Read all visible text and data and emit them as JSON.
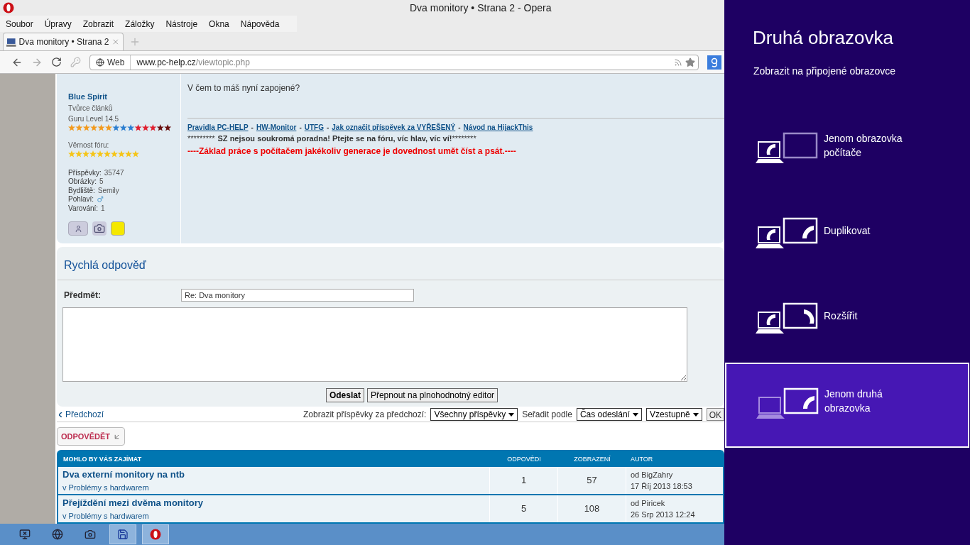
{
  "window": {
    "title": "Dva monitory • Strana 2 - Opera"
  },
  "menu": [
    "Soubor",
    "Úpravy",
    "Zobrazit",
    "Záložky",
    "Nástroje",
    "Okna",
    "Nápověda"
  ],
  "tabs": [
    {
      "label": "Dva monitory • Strana 2",
      "selected": true
    }
  ],
  "address": {
    "badge": "Web",
    "domain": "www.pc-help.cz",
    "path": "/viewtopic.php"
  },
  "post": {
    "author": "Blue Spirit",
    "rank": "Tvůrce článků",
    "level": "Guru Level 14.5",
    "loyalty_label": "Věrnost fóru:",
    "stars": 10,
    "details": [
      {
        "label": "Příspěvky:",
        "value": "35747"
      },
      {
        "label": "Obrázky:",
        "value": "5"
      },
      {
        "label": "Bydliště:",
        "value": "Semily"
      },
      {
        "label": "Pohlaví:",
        "kind": "male"
      },
      {
        "label": "Varování:",
        "value": "1"
      }
    ],
    "body": "V čem to máš nyní zapojené?",
    "sig_links": [
      "Pravidla PC-HELP",
      "HW-Monitor",
      "UTFG",
      "Jak označit příspěvek za VYŘEŠENÝ",
      "Návod na HijackThis"
    ],
    "sig_separator": "-",
    "sig_line2": {
      "prefix": "*********",
      "bold": "SZ nejsou soukromá poradna! Ptejte se na fóru, víc hlav, víc ví!",
      "suffix": "********"
    },
    "sig_line3": "----Základ práce s počítačem jakékoliv generace je dovednost umět číst a psát.----"
  },
  "quick_reply": {
    "title": "Rychlá odpověď",
    "subject_label": "Předmět:",
    "subject_value": "Re: Dva monitory",
    "submit": "Odeslat",
    "full_editor": "Přepnout na plnohodnotný editor"
  },
  "pagination": {
    "prev": "Předchozí",
    "show_label": "Zobrazit příspěvky za předchozí:",
    "show_value": "Všechny příspěvky",
    "sort_label": "Seřadit podle",
    "sort_value": "Čas odeslání",
    "order_value": "Vzestupně",
    "ok": "OK"
  },
  "reply_button": "ODPOVĚDĚT",
  "related": {
    "columns": [
      "MOHLO BY VÁS ZAJÍMAT",
      "ODPOVĚDI",
      "ZOBRAZENÍ",
      "AUTOR"
    ],
    "rows": [
      {
        "title": "Dva externí monitory na ntb",
        "forum": "v Problémy s hardwarem",
        "replies": "1",
        "views": "57",
        "author": "od BigZahry",
        "date": "17 Říj 2013 18:53"
      },
      {
        "title": "Přejíždění mezi dvěma monitory",
        "forum": "v Problémy s hardwarem",
        "replies": "5",
        "views": "108",
        "author": "od Piricek",
        "date": "26 Srp 2013 12:24"
      }
    ]
  },
  "taskbar": [
    {
      "kind": "display",
      "active": false
    },
    {
      "kind": "globe",
      "active": false
    },
    {
      "kind": "camera",
      "active": false
    },
    {
      "kind": "save",
      "active": true
    },
    {
      "kind": "opera",
      "active": true
    }
  ],
  "project": {
    "title": "Druhá obrazovka",
    "subtitle": "Zobrazit na připojené obrazovce",
    "options": [
      {
        "kind": "pc_only",
        "label": "Jenom obrazovka počítače",
        "selected": false
      },
      {
        "kind": "duplicate",
        "label": "Duplikovat",
        "selected": false
      },
      {
        "kind": "extend",
        "label": "Rozšířit",
        "selected": false
      },
      {
        "kind": "second_only",
        "label": "Jenom druhá obrazovka",
        "selected": true
      }
    ]
  }
}
